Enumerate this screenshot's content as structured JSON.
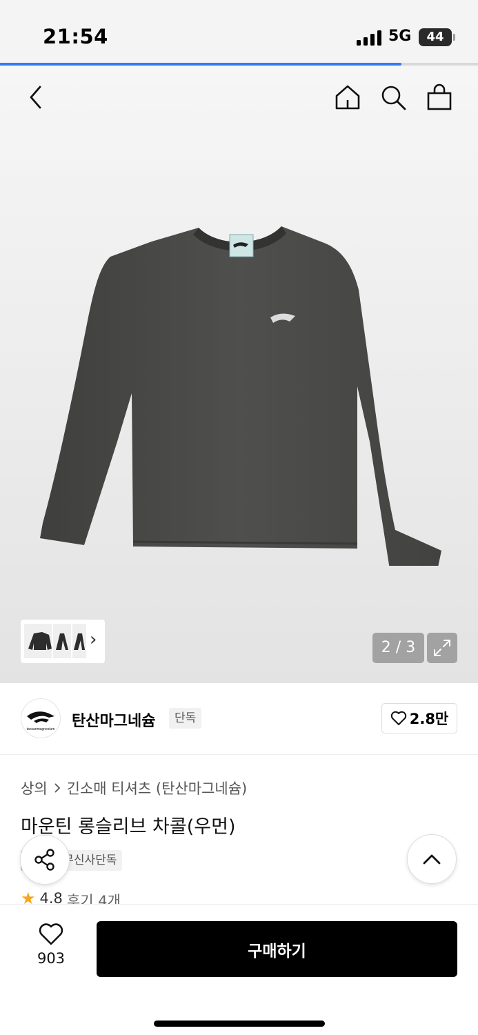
{
  "status_bar": {
    "time": "21:54",
    "network": "5G",
    "battery": "44"
  },
  "page_progress": 0.84,
  "header": {
    "back_icon": "chevron-left-icon",
    "home_icon": "home-icon",
    "search_icon": "search-icon",
    "cart_icon": "shopping-bag-icon"
  },
  "gallery": {
    "counter": "2 / 3",
    "expand_icon": "expand-icon",
    "thumbnail_arrow": "›"
  },
  "brand": {
    "name": "탄산마그네슘",
    "logo_text": "tansanmagnesium",
    "badge": "단독",
    "likes": "2.8만"
  },
  "product": {
    "breadcrumb": [
      "상의",
      "긴소매 티셔츠 (탄산마그네슘)"
    ],
    "title": "마운틴 롱슬리브 차콜(우먼)",
    "tags": [
      "세일",
      "무신사단독"
    ],
    "rating": "4.8",
    "reviews": "후기 4개"
  },
  "bottom_bar": {
    "wish_count": "903",
    "buy_label": "구매하기"
  },
  "colors": {
    "progress": "#2e7bf6",
    "sale_tag": "#e79b5d",
    "star": "#f4a71f",
    "buy_button": "#000000",
    "shirt": "#4a4a48"
  }
}
